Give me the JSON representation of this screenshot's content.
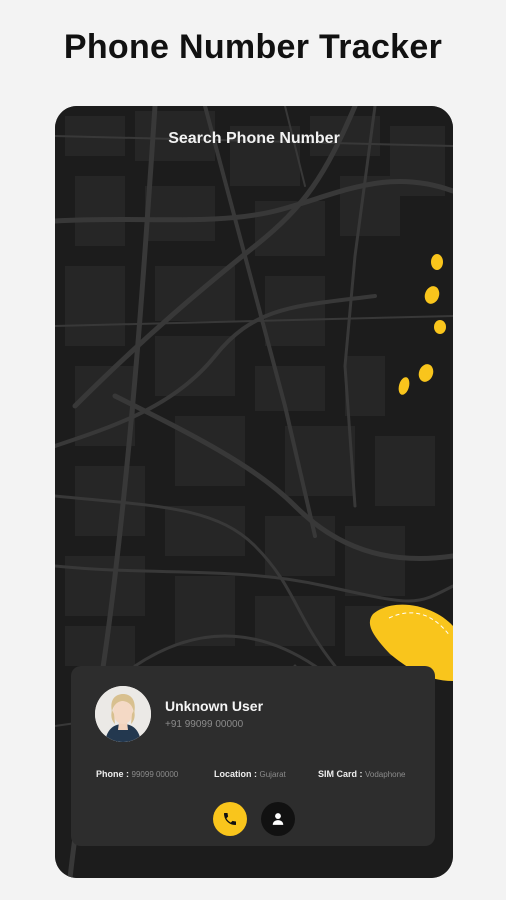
{
  "header": {
    "title": "Phone Number Tracker"
  },
  "screen": {
    "title": "Search Phone Number"
  },
  "card": {
    "name": "Unknown User",
    "number": "+91 99099 00000",
    "info": [
      {
        "label": "Phone",
        "value": "99099 00000"
      },
      {
        "label": "Location",
        "value": "Gujarat"
      },
      {
        "label": "SIM Card",
        "value": "Vodaphone"
      }
    ],
    "separator": " : "
  },
  "actions": {
    "call_icon": "phone-icon",
    "contact_icon": "user-icon"
  },
  "colors": {
    "accent": "#f9c51c",
    "map_background": "#1c1c1c",
    "card_background": "#2d2d2d"
  }
}
